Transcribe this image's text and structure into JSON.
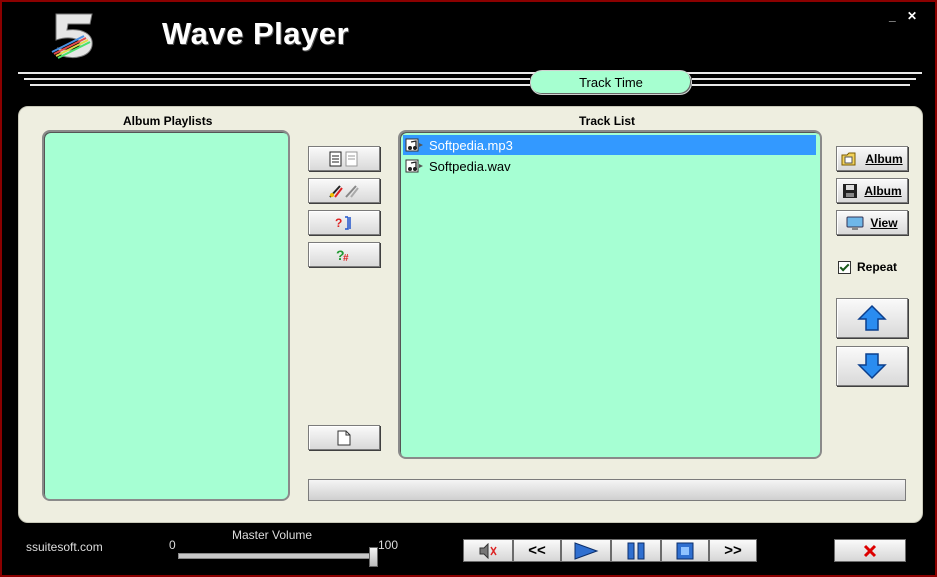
{
  "app": {
    "title": "Wave Player",
    "minimize_glyph": "_",
    "close_glyph": "✕"
  },
  "header": {
    "track_time_label": "Track Time"
  },
  "playlists": {
    "heading": "Album Playlists",
    "items": []
  },
  "tracklist": {
    "heading": "Track List",
    "items": [
      {
        "name": "Softpedia.mp3",
        "icon": "music-file-icon",
        "selected": true
      },
      {
        "name": "Softpedia.wav",
        "icon": "wave-file-icon",
        "selected": false
      }
    ]
  },
  "side_buttons": {
    "open_album_label": "Album",
    "save_album_label": "Album",
    "view_label": "View",
    "repeat_label": "Repeat",
    "repeat_checked": true
  },
  "footer": {
    "site": "ssuitesoft.com",
    "volume_label": "Master Volume",
    "volume_min": "0",
    "volume_max": "100",
    "volume_value": 100,
    "prev_label": "<<",
    "next_label": ">>"
  },
  "colors": {
    "list_bg": "#a6ffd3",
    "selection": "#3399ff",
    "panel": "#eeeee0",
    "frame": "#8b0000"
  }
}
